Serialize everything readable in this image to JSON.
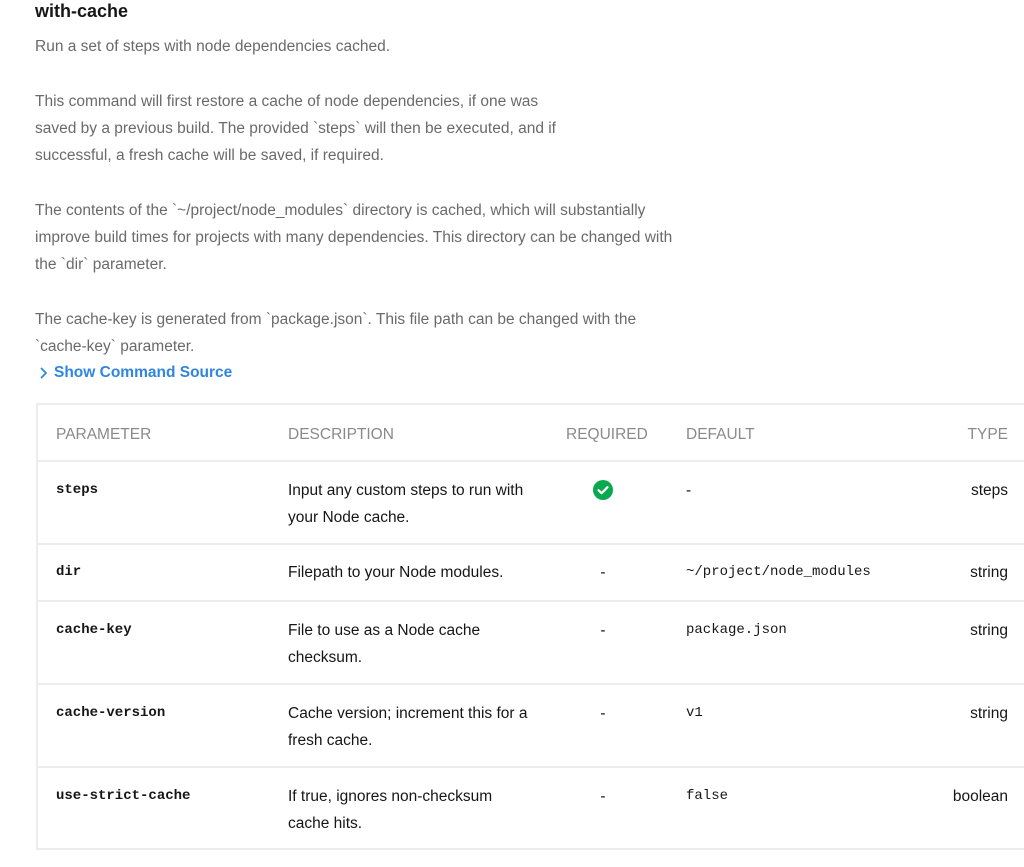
{
  "command": {
    "title": "with-cache",
    "paragraphs": [
      "Run a set of steps with node dependencies cached.",
      "This command will first restore a cache of node dependencies, if one was saved by a previous build. The provided `steps` will then be executed, and if successful, a fresh cache will be saved, if required.",
      "The contents of the `~/project/node_modules` directory is cached, which will substantially improve build times for projects with many dependencies. This directory can be changed with the `dir` parameter.",
      "The cache-key is generated from `package.json`. This file path can be changed with the `cache-key` parameter."
    ],
    "show_source_label": "Show Command Source"
  },
  "table": {
    "headers": {
      "parameter": "PARAMETER",
      "description": "DESCRIPTION",
      "required": "REQUIRED",
      "default": "DEFAULT",
      "type": "TYPE"
    },
    "rows": [
      {
        "name": "steps",
        "description": "Input any custom steps to run with your Node cache.",
        "required": true,
        "required_text": "",
        "default": "-",
        "type": "steps"
      },
      {
        "name": "dir",
        "description": "Filepath to your Node modules.",
        "required": false,
        "required_text": "-",
        "default": "~/project/node_modules",
        "type": "string"
      },
      {
        "name": "cache-key",
        "description": "File to use as a Node cache checksum.",
        "required": false,
        "required_text": "-",
        "default": "package.json",
        "type": "string"
      },
      {
        "name": "cache-version",
        "description": "Cache version; increment this for a fresh cache.",
        "required": false,
        "required_text": "-",
        "default": "v1",
        "type": "string"
      },
      {
        "name": "use-strict-cache",
        "description": "If true, ignores non-checksum cache hits.",
        "required": false,
        "required_text": "-",
        "default": "false",
        "type": "boolean"
      }
    ]
  },
  "colors": {
    "link": "#2e86de",
    "check": "#0ba94f",
    "muted_text": "#6a6a6a",
    "border": "#ececec"
  },
  "icons": {
    "toggle": "chevron-right-icon",
    "required": "check-circle-icon"
  }
}
